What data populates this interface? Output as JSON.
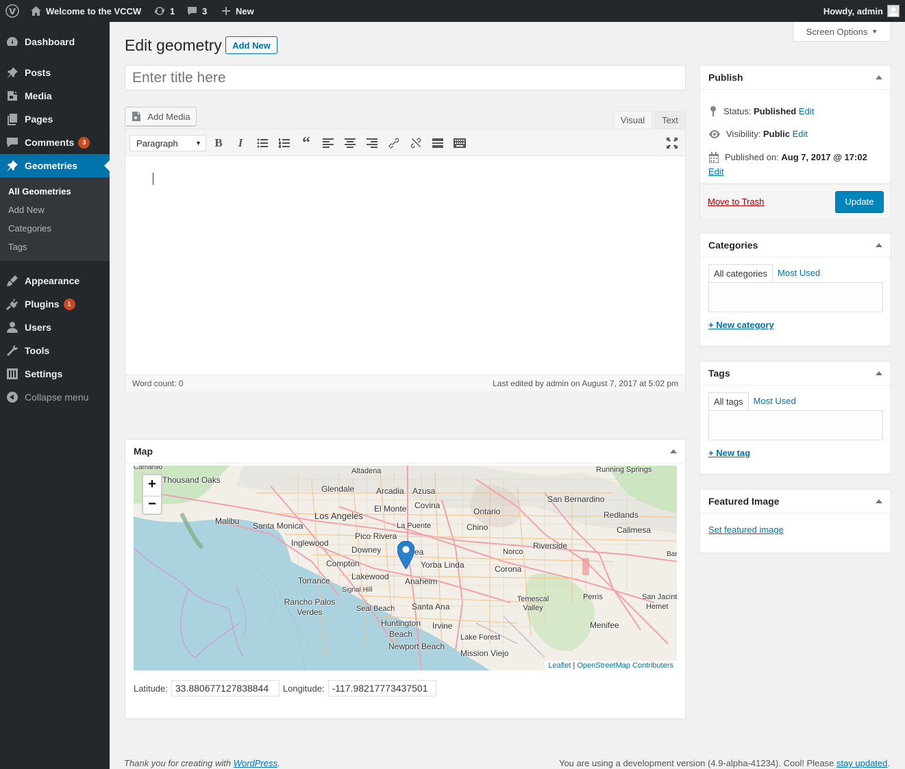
{
  "admin_bar": {
    "site_name": "Welcome to the VCCW",
    "updates_count": "1",
    "comments_count": "3",
    "new_label": "New",
    "howdy": "Howdy, admin"
  },
  "sidebar": {
    "items": [
      {
        "label": "Dashboard",
        "icon": "dashboard-icon"
      },
      {
        "label": "Posts",
        "icon": "pin-icon"
      },
      {
        "label": "Media",
        "icon": "media-icon"
      },
      {
        "label": "Pages",
        "icon": "pages-icon"
      },
      {
        "label": "Comments",
        "icon": "comment-icon",
        "badge": "3"
      },
      {
        "label": "Geometries",
        "icon": "pin-icon"
      },
      {
        "label": "Appearance",
        "icon": "brush-icon"
      },
      {
        "label": "Plugins",
        "icon": "plugin-icon",
        "badge": "1"
      },
      {
        "label": "Users",
        "icon": "user-icon"
      },
      {
        "label": "Tools",
        "icon": "wrench-icon"
      },
      {
        "label": "Settings",
        "icon": "settings-icon"
      },
      {
        "label": "Collapse menu",
        "icon": "collapse-icon"
      }
    ],
    "submenu": [
      "All Geometries",
      "Add New",
      "Categories",
      "Tags"
    ]
  },
  "page": {
    "title": "Edit geometry",
    "add_new": "Add New",
    "screen_options": "Screen Options",
    "title_placeholder": "Enter title here"
  },
  "editor": {
    "add_media": "Add Media",
    "tab_visual": "Visual",
    "tab_text": "Text",
    "format": "Paragraph",
    "word_count": "Word count: 0",
    "last_edited": "Last edited by admin on August 7, 2017 at 5:02 pm"
  },
  "publish": {
    "heading": "Publish",
    "status_label": "Status:",
    "status_value": "Published",
    "visibility_label": "Visibility:",
    "visibility_value": "Public",
    "published_label": "Published on:",
    "published_value": "Aug 7, 2017 @ 17:02",
    "edit": "Edit",
    "trash": "Move to Trash",
    "update": "Update"
  },
  "categories": {
    "heading": "Categories",
    "tab_all": "All categories",
    "tab_used": "Most Used",
    "add_link": "+ New category"
  },
  "tags": {
    "heading": "Tags",
    "tab_all": "All tags",
    "tab_used": "Most Used",
    "add_link": "+ New tag"
  },
  "featured": {
    "heading": "Featured Image",
    "link": "Set featured image"
  },
  "map_box": {
    "heading": "Map",
    "zoom_in": "+",
    "zoom_out": "−",
    "attribution_leaflet": "Leaflet",
    "attribution_osm": "OpenStreetMap Contributers",
    "latitude_label": "Latitude:",
    "latitude": "33.880677127838844",
    "longitude_label": "Longitude:",
    "longitude": "-117.98217773437501",
    "places": [
      "Thousand Oaks",
      "Altadena",
      "Running Springs",
      "Glendale",
      "Arcadia",
      "Azusa",
      "San Bernardino",
      "El Monte",
      "Covina",
      "Ontario",
      "Los Angeles",
      "Redlands",
      "Malibu",
      "Santa Monica",
      "La Puente",
      "Chino",
      "Calimesa",
      "Pico Rivera",
      "Inglewood",
      "Downey",
      "Riverside",
      "Norco",
      "Yorba Linda",
      "Compton",
      "Corona",
      "Lakewood",
      "Anaheim",
      "Torrance",
      "Signal Hill",
      "Rancho Palos Verdes",
      "Seal Beach",
      "Santa Ana",
      "Temescal Valley",
      "Perris",
      "San Jacinto",
      "Hemet",
      "Huntington Beach",
      "Irvine",
      "Menifee",
      "Lake Forest",
      "Newport Beach",
      "Mission Viejo",
      "Malibu",
      "Bar",
      "Brea",
      "Camarillo"
    ]
  },
  "footer": {
    "thanks": "Thank you for creating with ",
    "wp": "WordPress",
    "version": "You are using a development version (4.9-alpha-41234). Cool! Please ",
    "stay": "stay updated"
  },
  "colors": {
    "accent": "#0073aa",
    "sidebar": "#23282d",
    "badge": "#ca4a1f",
    "button": "#0085ba"
  }
}
